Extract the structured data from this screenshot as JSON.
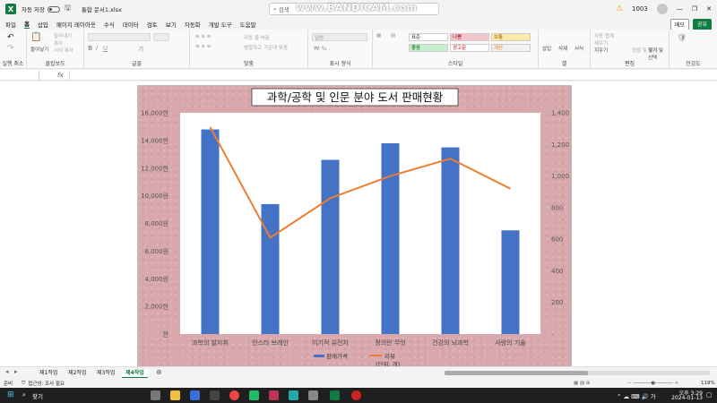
{
  "titlebar": {
    "autosave_label": "자동 저장",
    "autosave_state": "끔",
    "filename": "통합 문서1.xlsx",
    "search_placeholder": "검색",
    "watermark": "www.BANDICAM.com",
    "user_id": "1003"
  },
  "menu": {
    "tabs": [
      "파일",
      "홈",
      "삽입",
      "페이지 레이아웃",
      "수식",
      "데이터",
      "검토",
      "보기",
      "자동화",
      "개발 도구",
      "도움말"
    ],
    "active": "홈",
    "memo_label": "메모",
    "share_label": "공유"
  },
  "ribbon": {
    "groups": [
      "실행 취소",
      "클립보드",
      "글꼴",
      "맞춤",
      "표시 형식",
      "스타일",
      "셀",
      "편집",
      "민감도"
    ],
    "clipboard_items": [
      "잘라내기",
      "복사",
      "서식 복사",
      "붙여넣기"
    ],
    "align_items": [
      "자동 줄 바꿈",
      "병합하고 가운데 맞춤"
    ],
    "number_format": "일반",
    "styles": [
      "표준",
      "나쁨",
      "보통",
      "좋음",
      "경고문",
      "계산"
    ],
    "cell_items": [
      "삽입",
      "삭제",
      "서식"
    ],
    "edit_items": [
      "자동 합계",
      "채우기",
      "지우기",
      "정렬 및 필터",
      "찾기 및 선택"
    ]
  },
  "formula": {
    "fx_label": "fx"
  },
  "chart_data": {
    "type": "bar+line",
    "title": "과학/공학 및 인문 분야 도서 판매현황",
    "categories": [
      "과학의 발자취",
      "인스타 브레인",
      "이기적 유전자",
      "정의란 무엇인가",
      "건강의 뇌과학",
      "사랑의 기술"
    ],
    "categories_display": [
      "과학의 발자취",
      "인스타 브레인",
      "이기적 유전자",
      "정의란 무엇",
      "건강의 뇌과학",
      "사랑의 기술"
    ],
    "series": [
      {
        "name": "판매가격",
        "type": "bar",
        "axis": "left",
        "color": "#4472c4",
        "values": [
          14800,
          9400,
          12600,
          13800,
          13500,
          7500
        ]
      },
      {
        "name": "리뷰",
        "type": "line",
        "axis": "right",
        "color": "#ed7d31",
        "values": [
          1310,
          610,
          860,
          1000,
          1110,
          920
        ]
      }
    ],
    "y_left": {
      "min": 0,
      "max": 16000,
      "ticks": [
        "원",
        "2,000원",
        "4,000원",
        "6,000원",
        "8,000원",
        "10,000원",
        "12,000원",
        "14,000원",
        "16,000원"
      ]
    },
    "y_right": {
      "min": 0,
      "max": 1400,
      "ticks": [
        "-",
        "200",
        "400",
        "600",
        "800",
        "1,000",
        "1,200",
        "1,400"
      ]
    },
    "legend_note": "(단위: 개)",
    "legend_position": "bottom"
  },
  "sheets": {
    "tabs": [
      "제1작업",
      "제2작업",
      "제3작업",
      "제4작업"
    ],
    "active": "제4작업"
  },
  "status": {
    "ready": "준비",
    "accessibility": "접근성: 조사 필요",
    "zoom": "119%"
  },
  "taskbar": {
    "search_label": "찾기",
    "time": "오후 3:29",
    "date": "2024-01-13"
  },
  "colors": {
    "excel_green": "#107c41",
    "chart_bg": "#d8a8ac",
    "bar": "#4472c4",
    "line": "#ed7d31"
  }
}
